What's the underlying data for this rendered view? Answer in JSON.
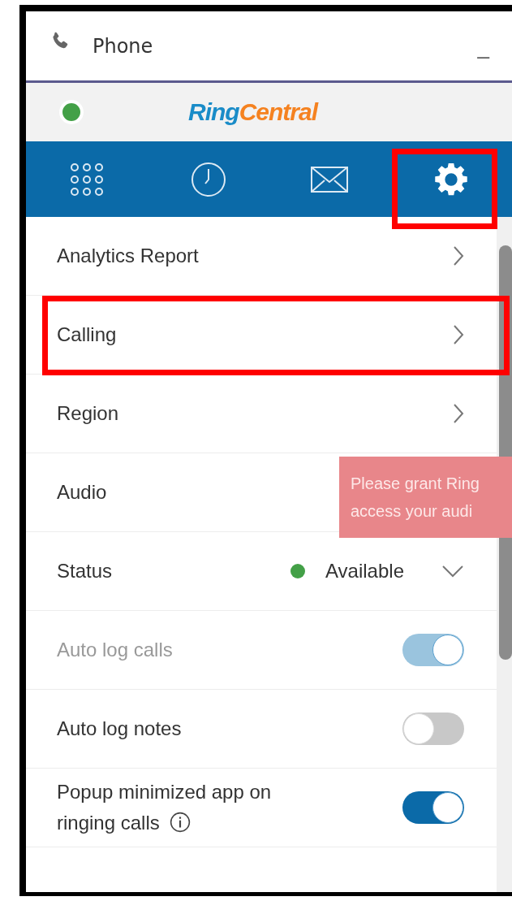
{
  "window": {
    "title": "Phone",
    "minimize": "_"
  },
  "header": {
    "color": "#43a047",
    "logo": [
      "Ring",
      "Central"
    ]
  },
  "tabs": [
    {
      "kind": "dialpad",
      "selected": false,
      "highlighted": false
    },
    {
      "kind": "history",
      "selected": false,
      "highlighted": false
    },
    {
      "kind": "messages",
      "selected": false,
      "highlighted": false
    },
    {
      "kind": "settings",
      "selected": true,
      "highlighted": true
    }
  ],
  "rows": [
    {
      "kind": "link",
      "label": "Analytics Report",
      "highlighted": false
    },
    {
      "kind": "link",
      "label": "Calling",
      "highlighted": true
    },
    {
      "kind": "link",
      "label": "Region",
      "highlighted": false
    },
    {
      "kind": "plain",
      "label": "Audio",
      "highlighted": false
    },
    {
      "kind": "status",
      "label": "Status",
      "value": "Available",
      "color": "#43a047",
      "highlighted": false
    },
    {
      "kind": "toggle",
      "label": "Auto log calls",
      "on": true,
      "disabled": true,
      "info": false,
      "highlighted": false
    },
    {
      "kind": "toggle",
      "label": "Auto log notes",
      "on": false,
      "disabled": false,
      "info": false,
      "highlighted": false
    },
    {
      "kind": "toggle",
      "label": "Popup minimized app on ringing calls",
      "on": true,
      "disabled": false,
      "info": true,
      "highlighted": false
    }
  ],
  "toast": {
    "lines": [
      "Please grant Ring",
      "access your audi"
    ]
  }
}
